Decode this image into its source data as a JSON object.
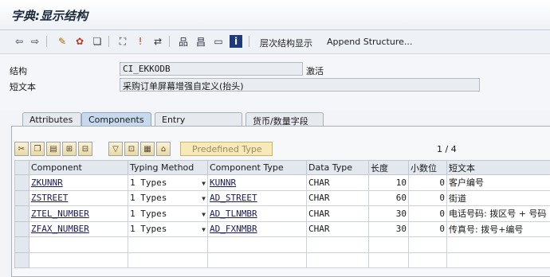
{
  "window": {
    "title": "字典:显示结构"
  },
  "toolbar": {
    "hierarchy_display": "层次结构显示",
    "append_structure": "Append Structure..."
  },
  "form": {
    "structure_label": "结构",
    "structure_value": "CI_EKKODB",
    "status": "激活",
    "short_text_label": "短文本",
    "short_text_value": "采购订单屏幕增强自定义(抬头)"
  },
  "tabs": [
    {
      "label": "Attributes"
    },
    {
      "label": "Components"
    },
    {
      "label": "Entry help/check"
    },
    {
      "label": "货币/数量字段"
    }
  ],
  "panel": {
    "predefined_type": "Predefined Type",
    "pager": "1 / 4"
  },
  "table": {
    "headers": [
      "Component",
      "Typing Method",
      "Component Type",
      "Data Type",
      "长度",
      "小数位",
      "短文本"
    ],
    "rows": [
      {
        "component": "ZKUNNR",
        "typing": "1 Types",
        "comp_type": "KUNNR",
        "data_type": "CHAR",
        "length": "10",
        "decimals": "0",
        "short_text": "客户编号"
      },
      {
        "component": "ZSTREET",
        "typing": "1 Types",
        "comp_type": "AD_STREET",
        "data_type": "CHAR",
        "length": "60",
        "decimals": "0",
        "short_text": "街道"
      },
      {
        "component": "ZTEL_NUMBER",
        "typing": "1 Types",
        "comp_type": "AD_TLNMBR",
        "data_type": "CHAR",
        "length": "30",
        "decimals": "0",
        "short_text": "电话号码: 拨区号 + 号码"
      },
      {
        "component": "ZFAX_NUMBER",
        "typing": "1 Types",
        "comp_type": "AD_FXNMBR",
        "data_type": "CHAR",
        "length": "30",
        "decimals": "0",
        "short_text": "传真号: 拨号+编号"
      }
    ]
  }
}
